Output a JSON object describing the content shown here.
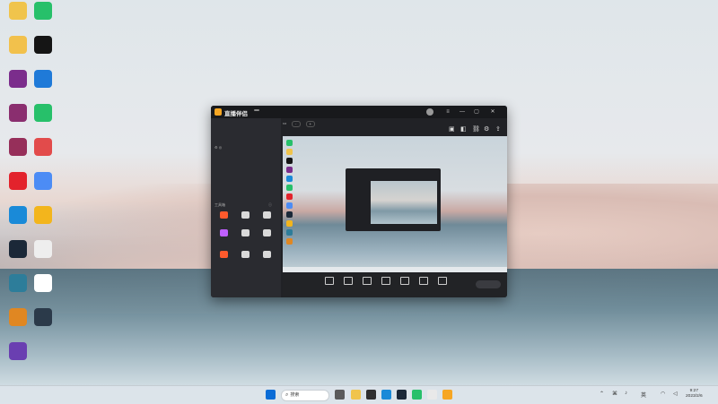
{
  "desktop": {
    "icons": [
      {
        "name": "folder-1",
        "label": "",
        "color": "#f0c44c"
      },
      {
        "name": "green-app",
        "label": "",
        "color": "#27c06a"
      },
      {
        "name": "folder-2",
        "label": "",
        "color": "#f2c14c"
      },
      {
        "name": "qq",
        "label": "",
        "color": "#151515"
      },
      {
        "name": "winrar-1",
        "label": "",
        "color": "#7b2d8c"
      },
      {
        "name": "edge-app",
        "label": "",
        "color": "#1f7ad8"
      },
      {
        "name": "winrar-2",
        "label": "",
        "color": "#8a2e6f"
      },
      {
        "name": "wechat",
        "label": "",
        "color": "#27c06a"
      },
      {
        "name": "winrar-3",
        "label": "",
        "color": "#962f5a"
      },
      {
        "name": "red-app",
        "label": "",
        "color": "#e24b4b"
      },
      {
        "name": "ea",
        "label": "",
        "color": "#e3232c"
      },
      {
        "name": "blue-app",
        "label": "",
        "color": "#4c8cf5"
      },
      {
        "name": "edge",
        "label": "",
        "color": "#1a8ad8"
      },
      {
        "name": "yellow-app",
        "label": "",
        "color": "#f3b51c"
      },
      {
        "name": "steam",
        "label": "",
        "color": "#1b2838"
      },
      {
        "name": "mobile-app",
        "label": "",
        "color": "#eeeeee"
      },
      {
        "name": "terminal",
        "label": "",
        "color": "#2d7d9a"
      },
      {
        "name": "document",
        "label": "",
        "color": "#ffffff"
      },
      {
        "name": "game-1",
        "label": "",
        "color": "#e08722"
      },
      {
        "name": "game-2",
        "label": "",
        "color": "#2b3a4a"
      },
      {
        "name": "game-3",
        "label": "",
        "color": "#6a3fb1"
      }
    ]
  },
  "app": {
    "title": "直播伴侣",
    "badge": "",
    "sidebar": {
      "tabs": [
        "",
        "",
        "",
        ""
      ],
      "tools_label": "工具箱",
      "tools": [
        {
          "label": "",
          "color": "#ff5a2c"
        },
        {
          "label": "",
          "color": "#d9d9d9"
        },
        {
          "label": "",
          "color": "#d9d9d9"
        },
        {
          "label": "",
          "color": "#c060ff"
        },
        {
          "label": "",
          "color": "#d9d9d9"
        },
        {
          "label": "",
          "color": "#d9d9d9"
        },
        {
          "label": "",
          "color": "#ff5a2c"
        },
        {
          "label": "",
          "color": "#d9d9d9"
        },
        {
          "label": "",
          "color": "#d9d9d9"
        }
      ],
      "footer": ""
    },
    "main": {
      "bottom_buttons": [
        {
          "label": ""
        },
        {
          "label": ""
        },
        {
          "label": ""
        },
        {
          "label": ""
        },
        {
          "label": ""
        },
        {
          "label": ""
        },
        {
          "label": ""
        }
      ],
      "golive": ""
    }
  },
  "right_panel": {
    "stats": [
      "",
      "",
      ""
    ],
    "lines": [
      "",
      "",
      "",
      "",
      "",
      "",
      "",
      "",
      "",
      "",
      "",
      "",
      "",
      "",
      ""
    ]
  },
  "taskbar": {
    "weather_temp": "",
    "weather_desc": "",
    "search_label": "搜索",
    "time": "9:27",
    "date": "2023/2/6"
  }
}
